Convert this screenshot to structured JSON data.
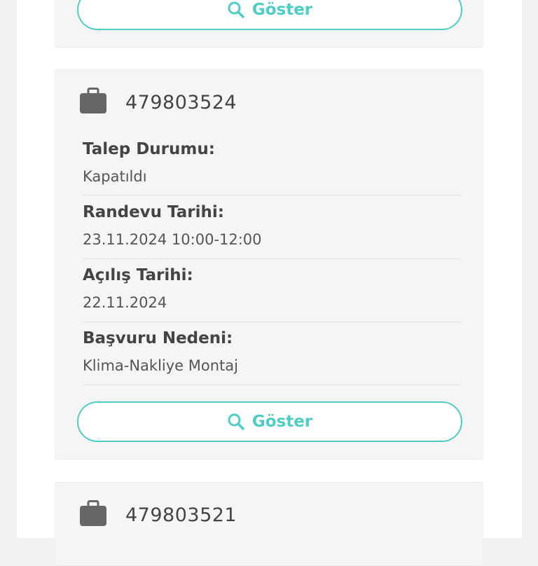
{
  "cards": [
    {
      "show_label": "Göster"
    },
    {
      "id": "479803524",
      "fields": [
        {
          "label": "Talep Durumu:",
          "value": "Kapatıldı"
        },
        {
          "label": "Randevu Tarihi:",
          "value": "23.11.2024 10:00-12:00"
        },
        {
          "label": "Açılış Tarihi:",
          "value": "22.11.2024"
        },
        {
          "label": "Başvuru Nedeni:",
          "value": "Klima-Nakliye Montaj"
        }
      ],
      "show_label": "Göster"
    },
    {
      "id": "479803521"
    }
  ],
  "colors": {
    "accent": "#4ecdc4",
    "icon": "#666666"
  },
  "icons": {
    "case": "briefcase-icon",
    "search": "search-icon"
  }
}
